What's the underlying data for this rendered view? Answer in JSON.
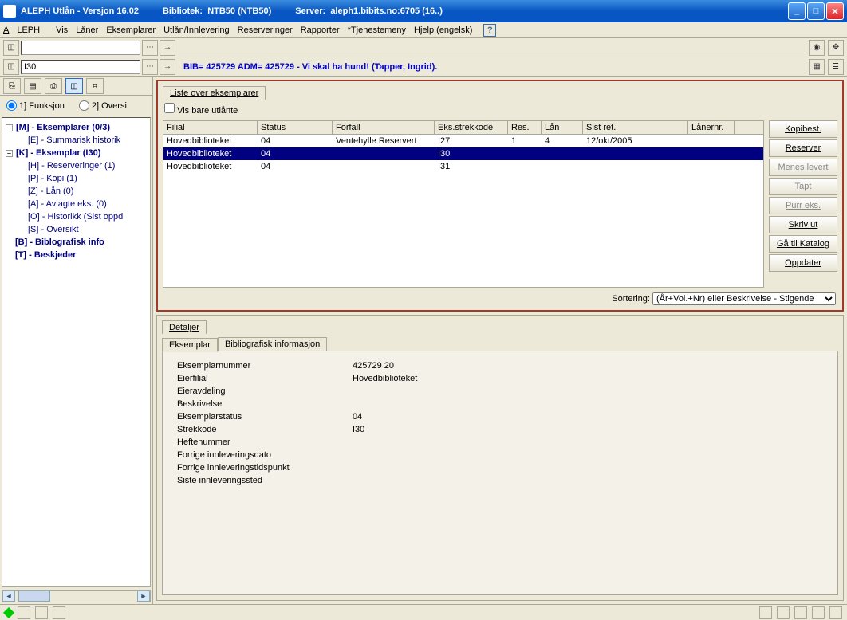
{
  "title": {
    "app": "ALEPH Utlån - Versjon 16.02",
    "lib_label": "Bibliotek:",
    "lib_value": "NTB50 (NTB50)",
    "srv_label": "Server:",
    "srv_value": "aleph1.bibits.no:6705 (16..)"
  },
  "menu": {
    "aleph": "ALEPH",
    "vis": "Vis",
    "laner": "Låner",
    "eks": "Eksemplarer",
    "utlan": "Utlån/Innlevering",
    "res": "Reserveringer",
    "rapp": "Rapporter",
    "tjen": "*Tjenestemeny",
    "hjelp": "Hjelp (engelsk)"
  },
  "toolbar": {
    "input1": "",
    "input2": "I30",
    "bibline": "BIB= 425729 ADM= 425729 - Vi skal ha hund! (Tapper, Ingrid)."
  },
  "left": {
    "radio1": "1] Funksjon",
    "radio2": "2] Oversi",
    "tree": {
      "m": "[M] - Eksemplarer (0/3)",
      "e": "[E] - Summarisk historik",
      "k": "[K] - Eksemplar (I30)",
      "h": "[H] - Reserveringer (1)",
      "p": "[P] - Kopi (1)",
      "z": "[Z] - Lån (0)",
      "a": "[A] - Avlagte eks. (0)",
      "o": "[O] - Historikk (Sist oppd",
      "s": "[S] - Oversikt",
      "b": "[B] - Biblografisk info",
      "t": "[T] - Beskjeder"
    }
  },
  "upper": {
    "tab": "Liste over eksemplarer",
    "chk": "Vis bare utlånte",
    "cols": {
      "filial": "Filial",
      "status": "Status",
      "forfall": "Forfall",
      "strek": "Eks.strekkode",
      "res": "Res.",
      "lan": "Lån",
      "sist": "Sist ret.",
      "laner": "Lånernr."
    },
    "rows": [
      {
        "filial": "Hovedbiblioteket",
        "status": "04",
        "forfall": "Ventehylle Reservert",
        "strek": "I27",
        "res": "1",
        "lan": "4",
        "sist": "12/okt/2005",
        "laner": ""
      },
      {
        "filial": "Hovedbiblioteket",
        "status": "04",
        "forfall": "",
        "strek": "I30",
        "res": "",
        "lan": "",
        "sist": "",
        "laner": ""
      },
      {
        "filial": "Hovedbiblioteket",
        "status": "04",
        "forfall": "",
        "strek": "I31",
        "res": "",
        "lan": "",
        "sist": "",
        "laner": ""
      }
    ],
    "buttons": {
      "kopi": "Kopibest.",
      "reserver": "Reserver",
      "menes": "Menes levert",
      "tapt": "Tapt",
      "purr": "Purr eks.",
      "skriv": "Skriv ut",
      "katalog": "Gå til Katalog",
      "oppdater": "Oppdater"
    },
    "sort_label": "Sortering:",
    "sort_value": "(År+Vol.+Nr) eller Beskrivelse - Stigende"
  },
  "lower": {
    "tab": "Detaljer",
    "subtabs": {
      "eks": "Eksemplar",
      "bib": "Bibliografisk informasjon"
    },
    "fields": {
      "eksnr_k": "Eksemplarnummer",
      "eksnr_v": "425729 20",
      "eier_k": "Eierfilial",
      "eier_v": "Hovedbiblioteket",
      "avd_k": "Eieravdeling",
      "avd_v": "",
      "besk_k": "Beskrivelse",
      "besk_v": "",
      "stat_k": "Eksemplarstatus",
      "stat_v": "04",
      "strek_k": "Strekkode",
      "strek_v": "I30",
      "heft_k": "Heftenummer",
      "heft_v": "",
      "fid_k": "Forrige innleveringsdato",
      "fid_v": "",
      "fit_k": "Forrige innleveringstidspunkt",
      "fit_v": "",
      "sis_k": "Siste innleveringssted",
      "sis_v": ""
    }
  }
}
